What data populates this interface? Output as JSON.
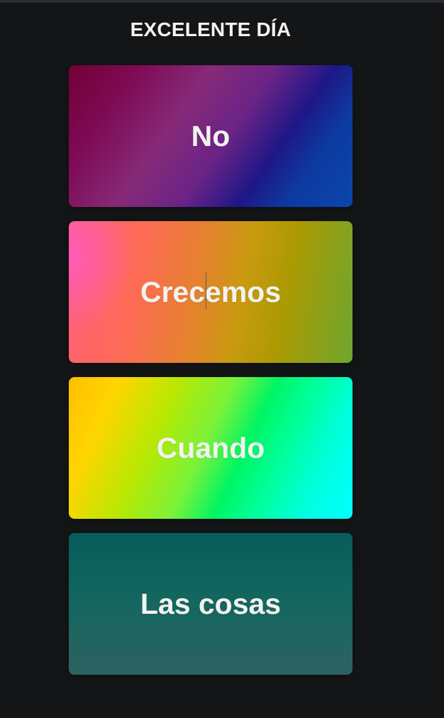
{
  "page": {
    "title": "EXCELENTE DÍA"
  },
  "cards": [
    {
      "label": "No"
    },
    {
      "label": "Crecemos"
    },
    {
      "label": "Cuando"
    },
    {
      "label": "Las cosas"
    }
  ],
  "colors": {
    "background": "#141517",
    "text": "#f2f2ee",
    "card_1_gradient": [
      "#730035",
      "#862a78",
      "#1e1786",
      "#0a46ad"
    ],
    "card_2_gradient": [
      "#ff5abe",
      "#fd6b55",
      "#c99a10",
      "#6ea62e"
    ],
    "card_3_gradient": [
      "#ffbe00",
      "#b8e802",
      "#00f562",
      "#00ffff"
    ],
    "card_4_gradient": [
      "#075c5b",
      "#2e6161"
    ]
  }
}
